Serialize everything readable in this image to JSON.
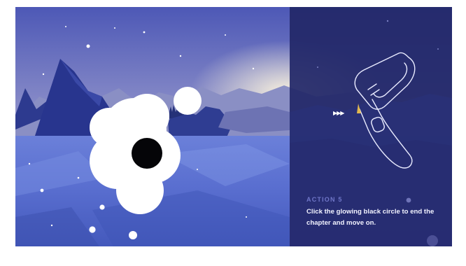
{
  "tutorial": {
    "action_title": "ACTION 5",
    "instruction": "Click the glowing black circle to end the chapter and move on.",
    "arrow_glyph": "▶▶▶"
  },
  "target": {
    "name": "glowing black circle",
    "state": "glowing"
  },
  "colors": {
    "panel": "#222868",
    "action_title": "#6f76c8",
    "text": "#f2f3ff",
    "target": "#050508",
    "glow": "#ffffff"
  },
  "icons": {
    "controller": "vr-controller-outline-icon",
    "arrows": "triple-arrow-icon"
  }
}
